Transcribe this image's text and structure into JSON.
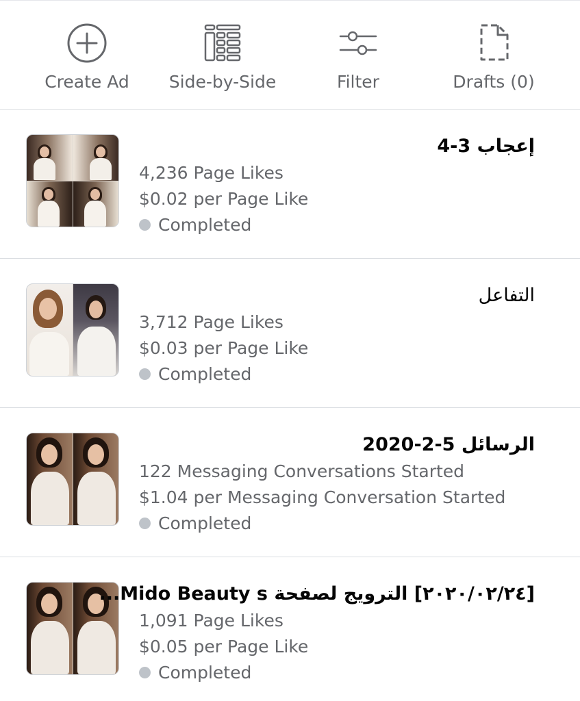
{
  "toolbar": {
    "create_ad": {
      "label": "Create Ad",
      "icon": "plus-circle-icon"
    },
    "side_by_side": {
      "label": "Side-by-Side",
      "icon": "columns-list-icon"
    },
    "filter": {
      "label": "Filter",
      "icon": "sliders-icon"
    },
    "drafts": {
      "label": "Drafts (0)",
      "icon": "document-draft-icon"
    }
  },
  "ads": [
    {
      "title": "إعجاب 3-4",
      "metric": "4,236 Page Likes",
      "cost": "$0.02 per Page Like",
      "status": "Completed",
      "thumbnail": "collage-4-bride-photos"
    },
    {
      "title": "التفاعل",
      "metric": "3,712 Page Likes",
      "cost": "$0.03 per Page Like",
      "status": "Completed",
      "thumbnail": "collage-2-bride-photos"
    },
    {
      "title": "الرسائل 5-2-2020",
      "metric": "122 Messaging Conversations Started",
      "cost": "$1.04 per Messaging Conversation Started",
      "status": "Completed",
      "thumbnail": "collage-2-bride-photos"
    },
    {
      "title": "[٢٠٢٠/٠٢/٢٤] الترويج لصفحة Mido Beauty s...",
      "metric": "1,091 Page Likes",
      "cost": "$0.05 per Page Like",
      "status": "Completed",
      "thumbnail": "collage-2-bride-photos"
    }
  ],
  "colors": {
    "secondary_text": "#65676b",
    "divider": "#dadde1",
    "status_dot": "#bec3c9"
  }
}
